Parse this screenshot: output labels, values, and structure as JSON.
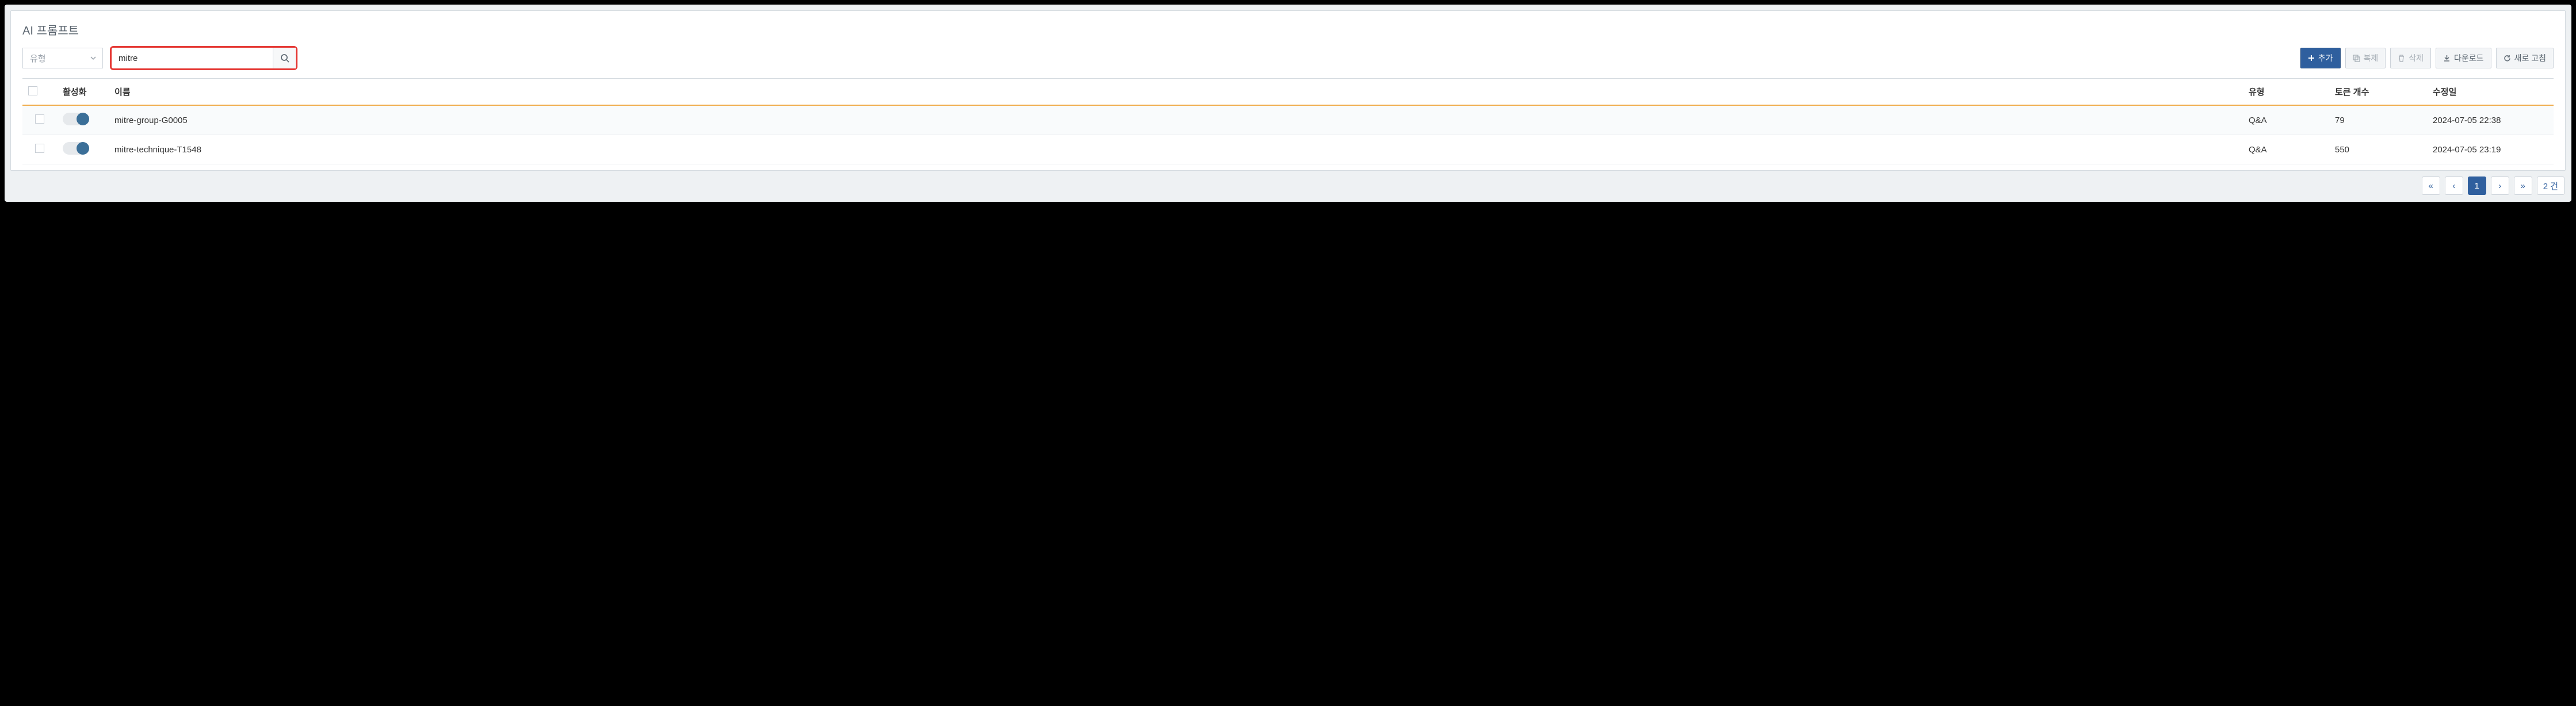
{
  "panel": {
    "title": "AI 프롬프트"
  },
  "filter": {
    "type_placeholder": "유형",
    "search_value": "mitre"
  },
  "actions": {
    "add": "추가",
    "copy": "복제",
    "delete": "삭제",
    "download": "다운로드",
    "refresh": "새로 고침"
  },
  "columns": {
    "active": "활성화",
    "name": "이름",
    "type": "유형",
    "tokens": "토큰 개수",
    "modified": "수정일"
  },
  "rows": [
    {
      "active": true,
      "name": "mitre-group-G0005",
      "type": "Q&A",
      "tokens": "79",
      "modified": "2024-07-05 22:38"
    },
    {
      "active": true,
      "name": "mitre-technique-T1548",
      "type": "Q&A",
      "tokens": "550",
      "modified": "2024-07-05 23:19"
    }
  ],
  "pagination": {
    "current": "1",
    "count_label": "2 건"
  }
}
